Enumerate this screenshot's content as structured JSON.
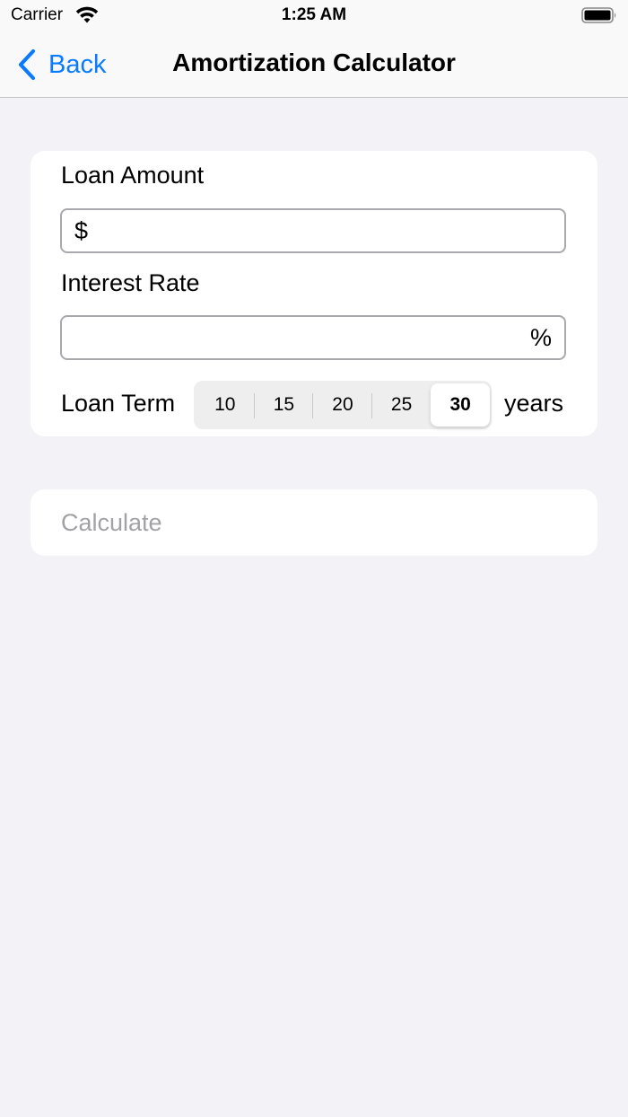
{
  "status_bar": {
    "carrier": "Carrier",
    "time": "1:25 AM"
  },
  "nav": {
    "back_label": "Back",
    "title": "Amortization Calculator"
  },
  "form": {
    "loan_amount": {
      "label": "Loan Amount",
      "prefix": "$",
      "value": ""
    },
    "interest_rate": {
      "label": "Interest Rate",
      "suffix": "%",
      "value": ""
    },
    "loan_term": {
      "label": "Loan Term",
      "options": [
        "10",
        "15",
        "20",
        "25",
        "30"
      ],
      "selected": "30",
      "unit": "years"
    }
  },
  "calculate_label": "Calculate",
  "colors": {
    "accent": "#0a7aff",
    "background": "#f2f2f7",
    "card": "#ffffff",
    "disabled_text": "#a2a2a6"
  }
}
